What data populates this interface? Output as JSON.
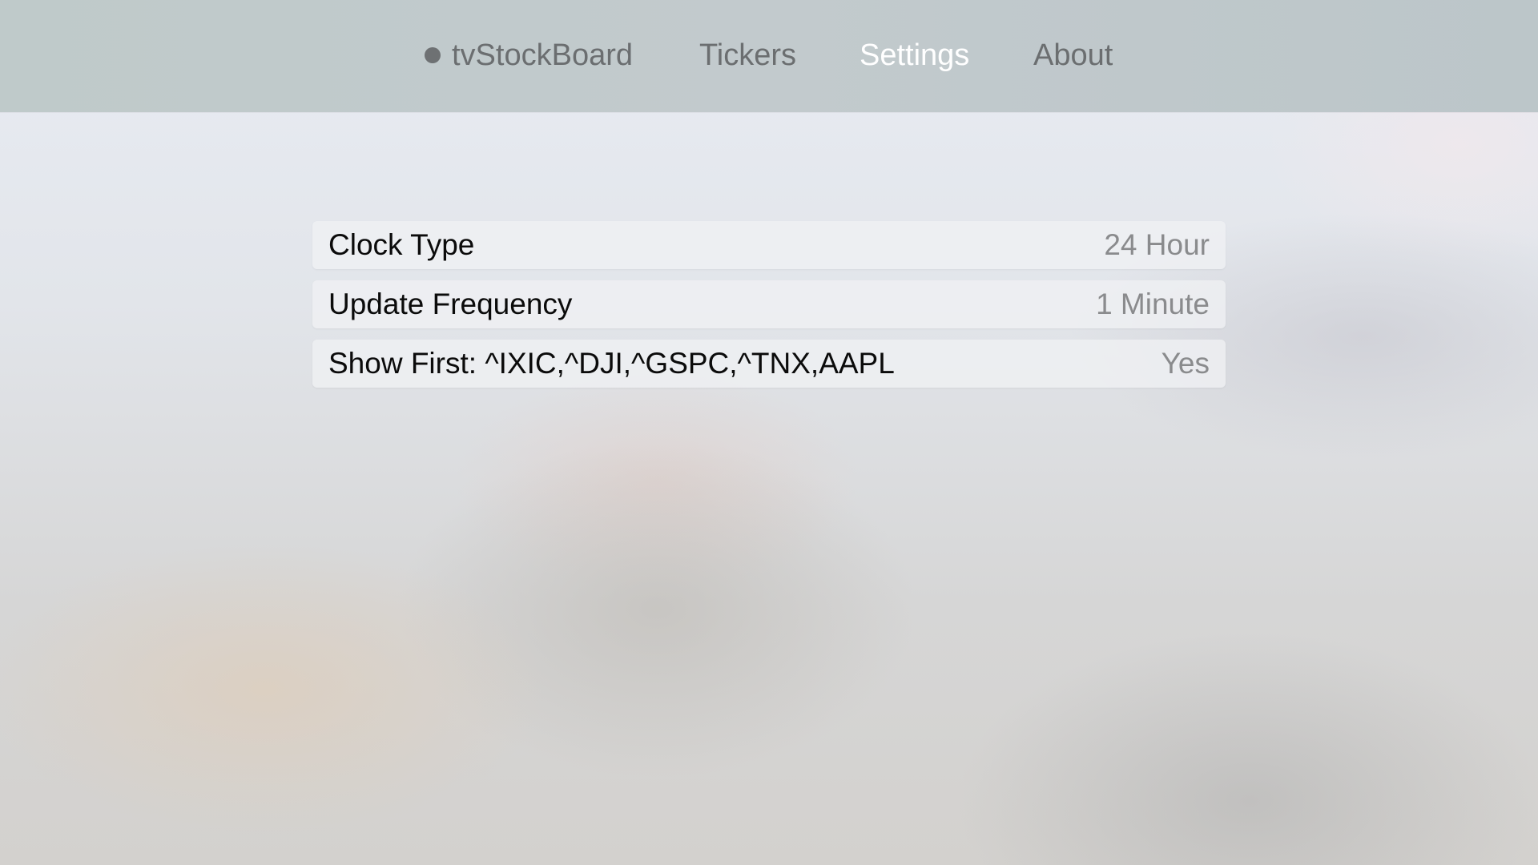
{
  "nav": {
    "brand": "tvStockBoard",
    "tabs": [
      {
        "label": "Tickers",
        "active": false
      },
      {
        "label": "Settings",
        "active": true
      },
      {
        "label": "About",
        "active": false
      }
    ]
  },
  "settings": {
    "rows": [
      {
        "label": "Clock Type",
        "value": "24 Hour"
      },
      {
        "label": "Update Frequency",
        "value": "1 Minute"
      },
      {
        "label": "Show First: ^IXIC,^DJI,^GSPC,^TNX,AAPL",
        "value": "Yes"
      }
    ]
  },
  "colors": {
    "active_tab": "#ffffff",
    "inactive_tab": "#6b6e70",
    "row_label": "#0b0b0b",
    "row_value": "#8a8b8d"
  }
}
